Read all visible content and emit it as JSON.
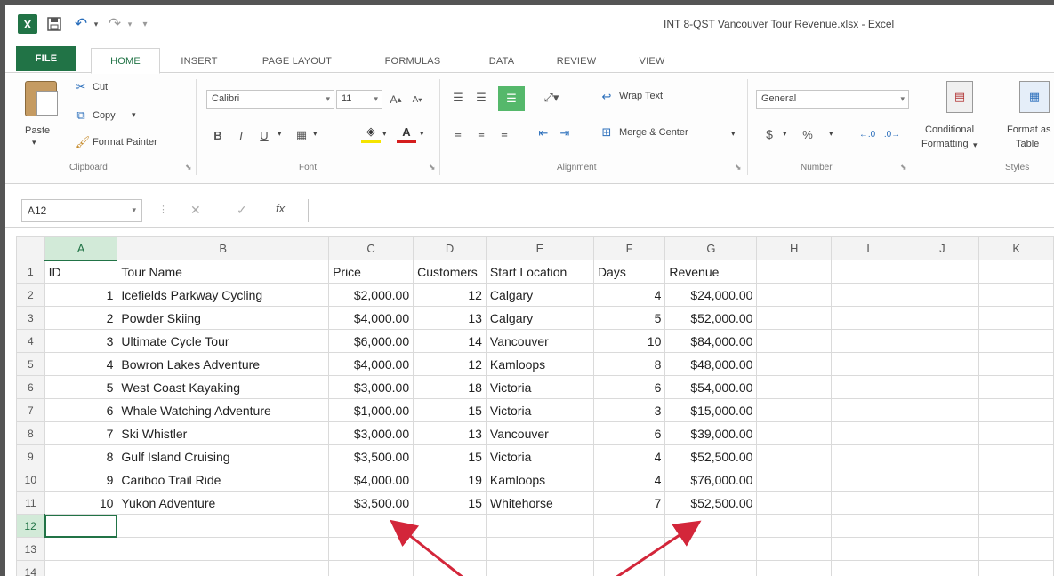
{
  "app": {
    "logo_text": "X",
    "window_title": "INT 8-QST Vancouver Tour Revenue.xlsx - Excel"
  },
  "tabs": [
    "FILE",
    "HOME",
    "INSERT",
    "PAGE LAYOUT",
    "FORMULAS",
    "DATA",
    "REVIEW",
    "VIEW"
  ],
  "ribbon": {
    "clipboard": {
      "paste": "Paste",
      "cut": "Cut",
      "copy": "Copy",
      "format_painter": "Format Painter",
      "group_label": "Clipboard"
    },
    "font": {
      "font_name": "Calibri",
      "font_size": "11",
      "group_label": "Font"
    },
    "alignment": {
      "wrap_text": "Wrap Text",
      "merge_center": "Merge & Center",
      "group_label": "Alignment"
    },
    "number": {
      "format": "General",
      "currency_symbol": "$",
      "percent_symbol": "%",
      "group_label": "Number"
    },
    "styles": {
      "conditional_line1": "Conditional",
      "conditional_line2": "Formatting",
      "format_table_line1": "Format as",
      "format_table_line2": "Table",
      "group_label": "Styles"
    }
  },
  "formula_bar": {
    "name_box": "A12",
    "fx": "fx",
    "value": ""
  },
  "sheet": {
    "columns": [
      "A",
      "B",
      "C",
      "D",
      "E",
      "F",
      "G",
      "H",
      "I",
      "J",
      "K"
    ],
    "headers": [
      "ID",
      "Tour Name",
      "Price",
      "Customers",
      "Start Location",
      "Days",
      "Revenue"
    ],
    "rows": [
      [
        "1",
        "Icefields Parkway Cycling",
        "$2,000.00",
        "12",
        "Calgary",
        "4",
        "$24,000.00"
      ],
      [
        "2",
        "Powder Skiing",
        "$4,000.00",
        "13",
        "Calgary",
        "5",
        "$52,000.00"
      ],
      [
        "3",
        "Ultimate Cycle Tour",
        "$6,000.00",
        "14",
        "Vancouver",
        "10",
        "$84,000.00"
      ],
      [
        "4",
        "Bowron Lakes Adventure",
        "$4,000.00",
        "12",
        "Kamloops",
        "8",
        "$48,000.00"
      ],
      [
        "5",
        "West Coast Kayaking",
        "$3,000.00",
        "18",
        "Victoria",
        "6",
        "$54,000.00"
      ],
      [
        "6",
        "Whale Watching Adventure",
        "$1,000.00",
        "15",
        "Victoria",
        "3",
        "$15,000.00"
      ],
      [
        "7",
        "Ski Whistler",
        "$3,000.00",
        "13",
        "Vancouver",
        "6",
        "$39,000.00"
      ],
      [
        "8",
        "Gulf Island Cruising",
        "$3,500.00",
        "15",
        "Victoria",
        "4",
        "$52,500.00"
      ],
      [
        "9",
        "Cariboo Trail Ride",
        "$4,000.00",
        "19",
        "Kamloops",
        "4",
        "$76,000.00"
      ],
      [
        "10",
        "Yukon Adventure",
        "$3,500.00",
        "15",
        "Whitehorse",
        "7",
        "$52,500.00"
      ]
    ],
    "row_numbers": [
      "1",
      "2",
      "3",
      "4",
      "5",
      "6",
      "7",
      "8",
      "9",
      "10",
      "11",
      "12",
      "13",
      "14"
    ],
    "selected_cell": "A12"
  },
  "colors": {
    "accent": "#217346",
    "arrow": "#d3263a"
  }
}
